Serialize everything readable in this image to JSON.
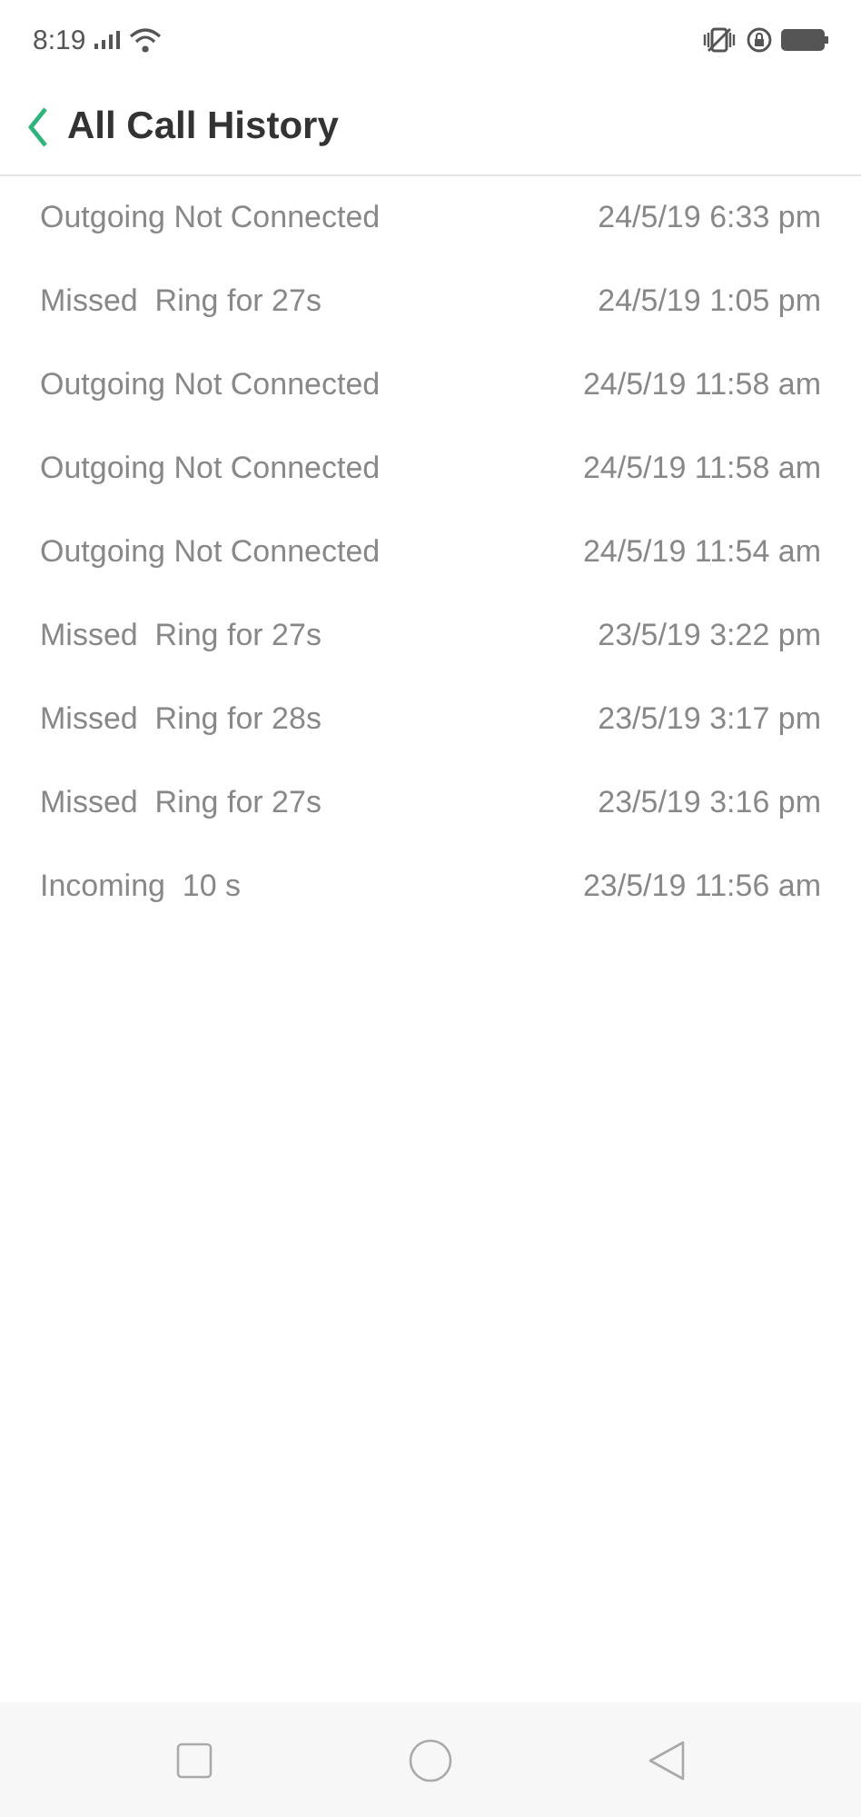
{
  "status_bar": {
    "time": "8:19"
  },
  "header": {
    "title": "All Call History"
  },
  "calls": [
    {
      "description": "Outgoing Not Connected",
      "datetime": "24/5/19 6:33 pm"
    },
    {
      "description": "Missed  Ring for 27s",
      "datetime": "24/5/19 1:05 pm"
    },
    {
      "description": "Outgoing Not Connected",
      "datetime": "24/5/19 11:58 am"
    },
    {
      "description": "Outgoing Not Connected",
      "datetime": "24/5/19 11:58 am"
    },
    {
      "description": "Outgoing Not Connected",
      "datetime": "24/5/19 11:54 am"
    },
    {
      "description": "Missed  Ring for 27s",
      "datetime": "23/5/19 3:22 pm"
    },
    {
      "description": "Missed  Ring for 28s",
      "datetime": "23/5/19 3:17 pm"
    },
    {
      "description": "Missed  Ring for 27s",
      "datetime": "23/5/19 3:16 pm"
    },
    {
      "description": "Incoming  10 s",
      "datetime": "23/5/19 11:56 am"
    }
  ]
}
